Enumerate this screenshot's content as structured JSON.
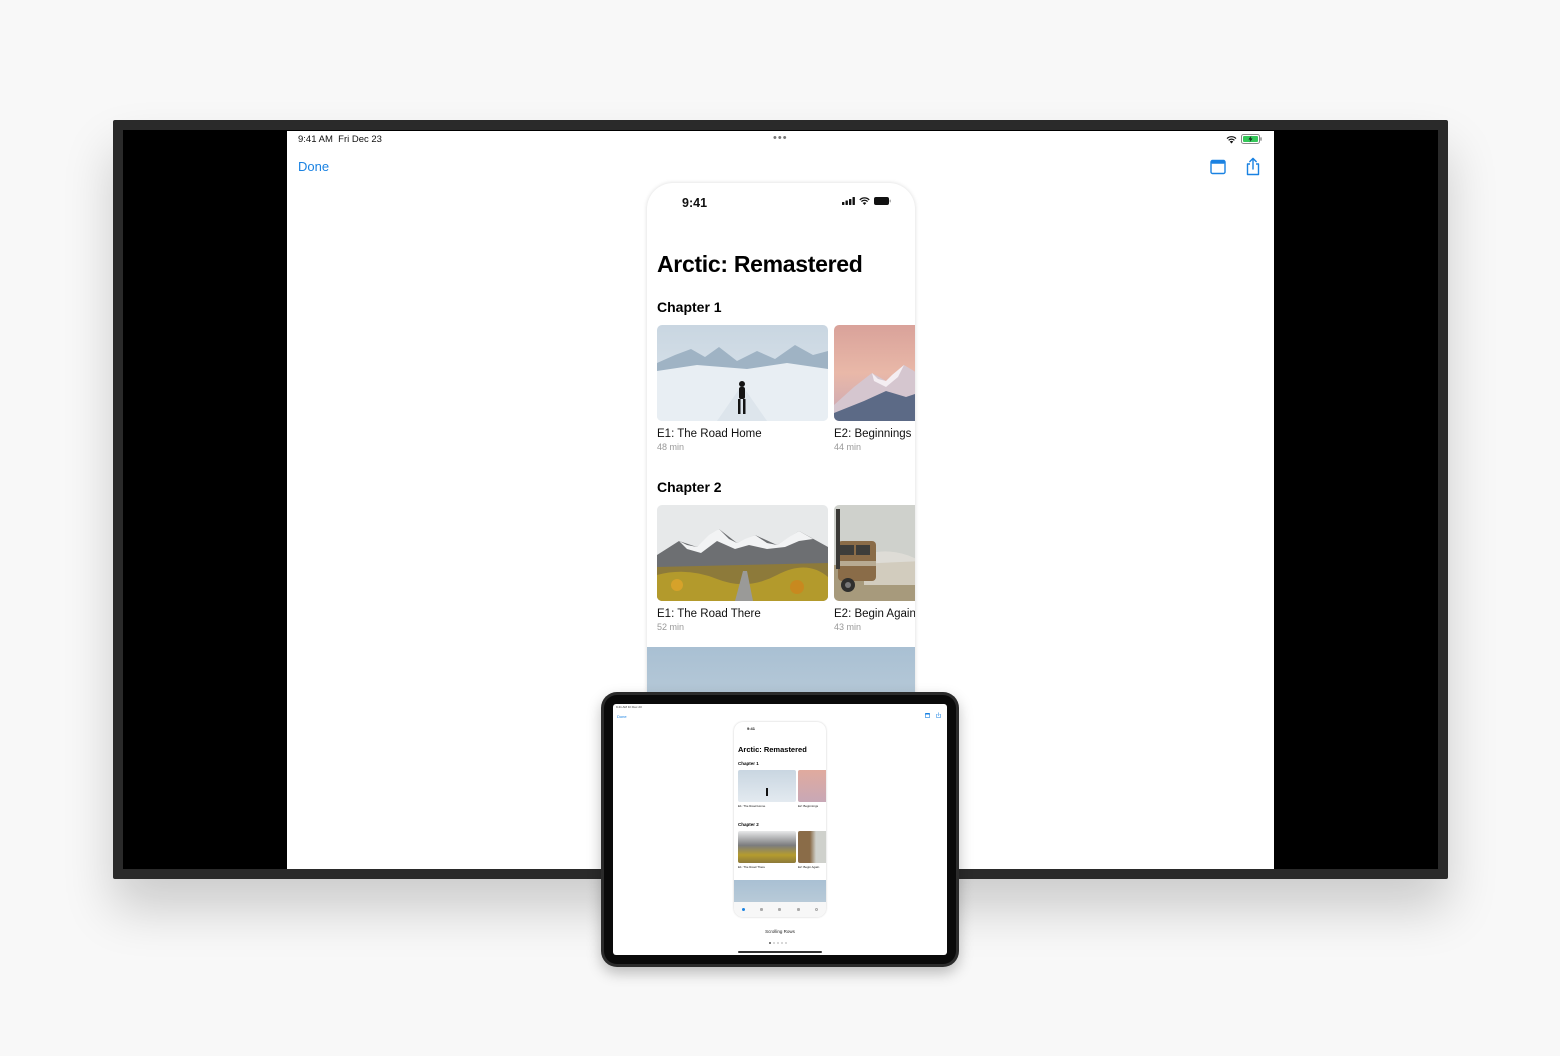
{
  "status_bar": {
    "time": "9:41 AM",
    "date": "Fri Dec 23",
    "dots": "•••"
  },
  "toolbar": {
    "done_label": "Done"
  },
  "phone": {
    "time": "9:41",
    "title": "Arctic: Remastered",
    "chapters": [
      {
        "title": "Chapter 1",
        "episodes": [
          {
            "title": "E1: The Road Home",
            "duration": "48 min"
          },
          {
            "title": "E2: Beginnings",
            "duration": "44 min"
          }
        ]
      },
      {
        "title": "Chapter 2",
        "episodes": [
          {
            "title": "E1: The Road There",
            "duration": "52 min"
          },
          {
            "title": "E2: Begin Again",
            "duration": "43 min"
          }
        ]
      }
    ]
  },
  "ipad": {
    "status": "9:41 AM  Fri Dec 23",
    "done_label": "Done",
    "caption": "Scrolling Rows"
  },
  "colors": {
    "accent": "#1a82e2",
    "battery_charging": "#34c759"
  }
}
